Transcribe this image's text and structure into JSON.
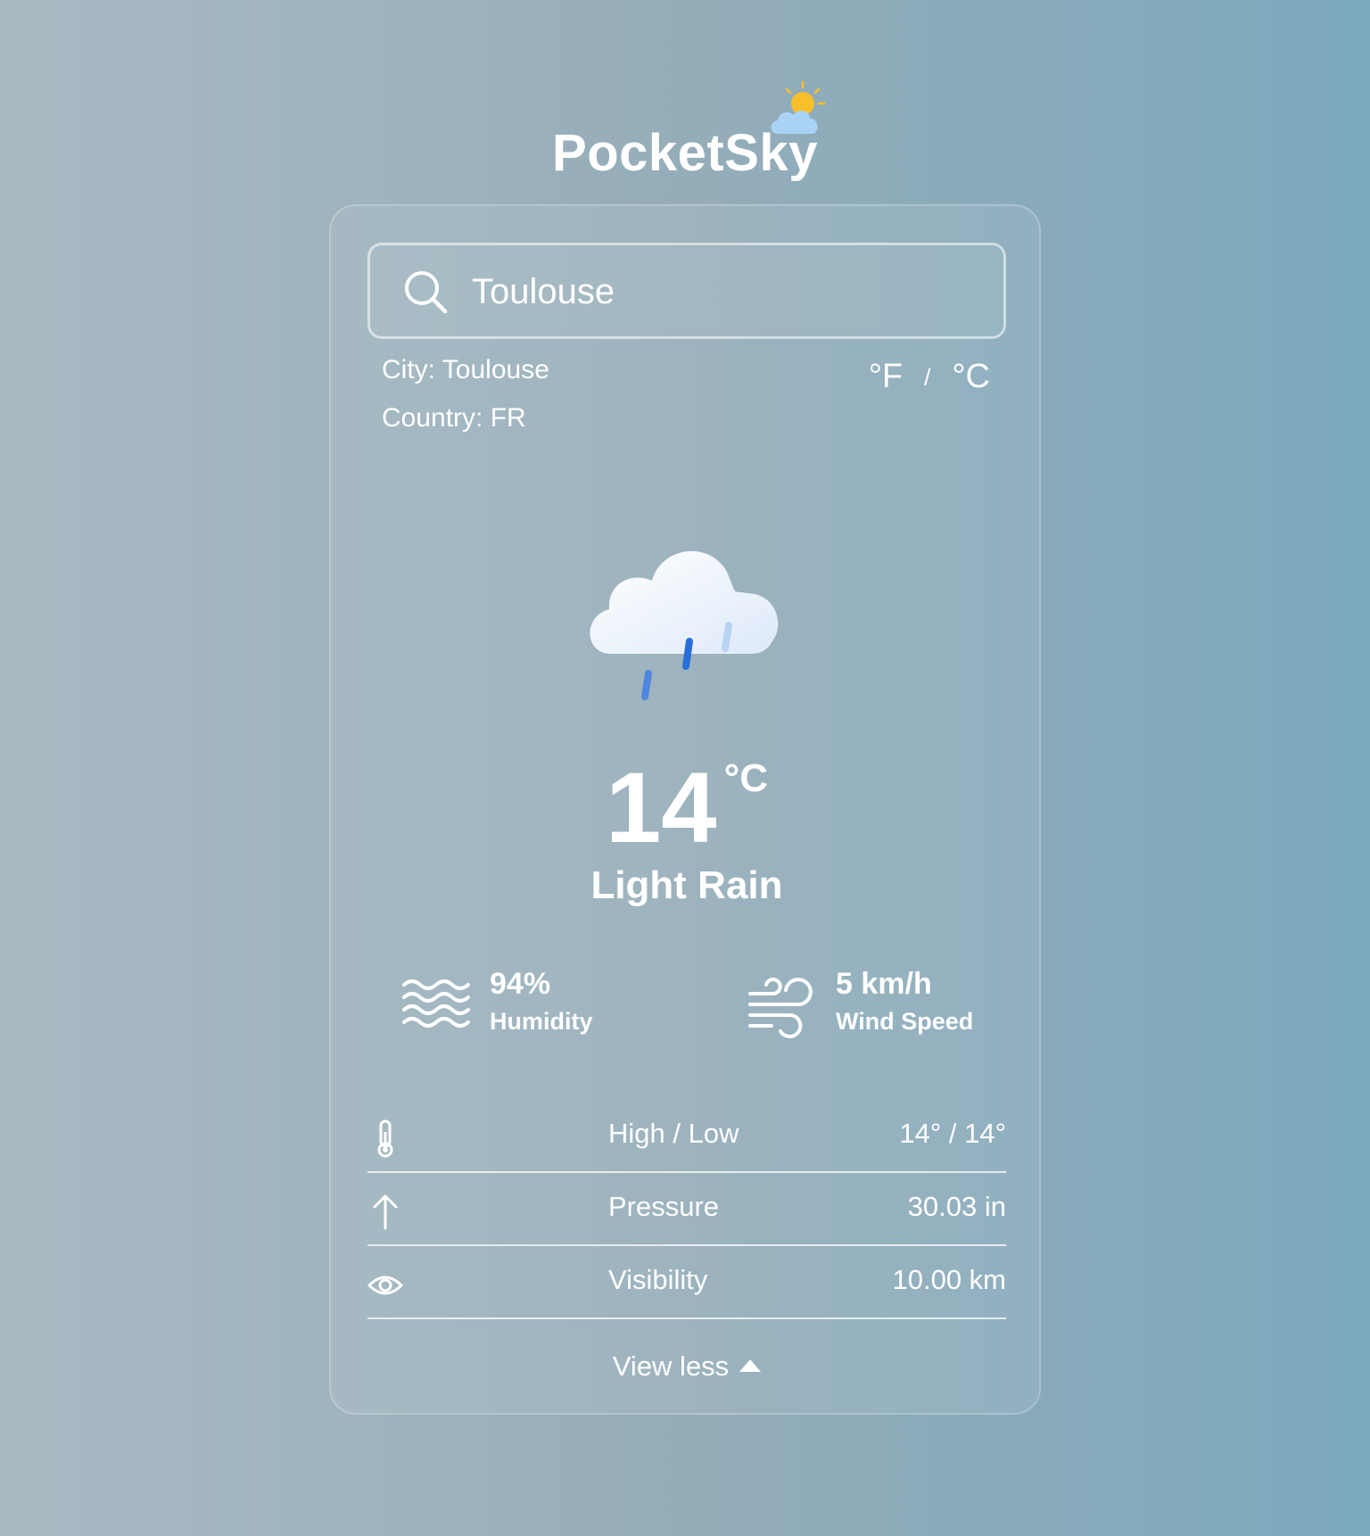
{
  "app": {
    "title": "PocketSky",
    "logo_icon": "sun-cloud-icon"
  },
  "search": {
    "value": "Toulouse",
    "icon": "search-icon"
  },
  "location": {
    "city_line": "City: Toulouse",
    "country_line": "Country: FR"
  },
  "units": {
    "fahrenheit": "°F",
    "separator": "/",
    "celsius": "°C"
  },
  "current": {
    "icon": "cloud-rain-icon",
    "temperature": "14",
    "temperature_unit": "°C",
    "condition": "Light Rain"
  },
  "stats": {
    "humidity": {
      "value": "94%",
      "label": "Humidity",
      "icon": "waves-icon"
    },
    "wind": {
      "value": "5 km/h",
      "label": "Wind Speed",
      "icon": "wind-icon"
    }
  },
  "details": [
    {
      "icon": "thermometer-icon",
      "label": "High / Low",
      "value": "14° / 14°"
    },
    {
      "icon": "arrow-up-icon",
      "label": "Pressure",
      "value": "30.03 in"
    },
    {
      "icon": "eye-icon",
      "label": "Visibility",
      "value": "10.00 km"
    }
  ],
  "toggle": {
    "label": "View less",
    "icon": "caret-up-icon"
  },
  "colors": {
    "sun": "#f7c02b",
    "cloud": "#eef4fc",
    "rain_dark": "#2a6fd9",
    "rain_light": "#b9d3f3"
  }
}
